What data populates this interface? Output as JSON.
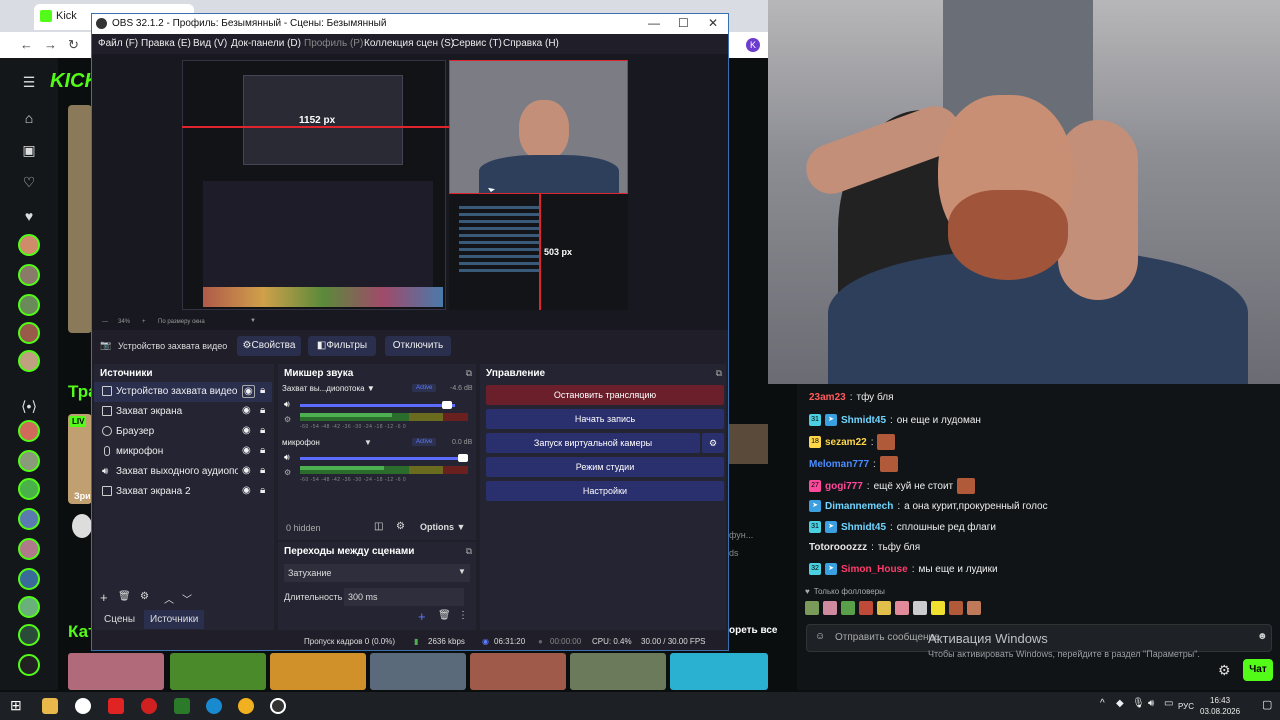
{
  "browser": {
    "tab_title": "Kick",
    "profile_letter": "K"
  },
  "kick": {
    "logo": "KICK",
    "following_letters": "Тра",
    "categories_letters": "Кат",
    "live_badge": "LIV",
    "name_partial": "Зри",
    "see_all": "ореть все",
    "fun_partial": "фун...",
    "ds_partial": "ds"
  },
  "chat": {
    "messages": [
      {
        "user": "23am23",
        "text": "тфу бля",
        "color": "#ff5a5a",
        "badges": []
      },
      {
        "user": "Shmidt45",
        "text": "он еще и лудоман",
        "color": "#6fd6ff",
        "badges": [
          "31",
          "p"
        ]
      },
      {
        "user": "sezam22",
        "text": "",
        "color": "#ffd84a",
        "badges": [
          "18"
        ],
        "emote": true
      },
      {
        "user": "Meloman777",
        "text": "",
        "color": "#4a8cff",
        "badges": [],
        "emote": true
      },
      {
        "user": "gogi777",
        "text": "ещё хуй не стоит",
        "color": "#ff4a9c",
        "badges": [
          "27"
        ],
        "emote": true
      },
      {
        "user": "Dimannemech",
        "text": "а она курит,прокуренный голос",
        "color": "#6fd6ff",
        "badges": [
          "p"
        ]
      },
      {
        "user": "Shmidt45",
        "text": "сплошные ред флаги",
        "color": "#6fd6ff",
        "badges": [
          "31",
          "p"
        ]
      },
      {
        "user": "Totorooozzz",
        "text": "тьфу бля",
        "color": "#e6e6e6",
        "badges": []
      },
      {
        "user": "Simon_House",
        "text": "мы еще и лудики",
        "color": "#ff3b6b",
        "badges": [
          "32",
          "p"
        ]
      }
    ],
    "followers_only": "Только фолловеры",
    "input_placeholder": "Отправить сообщение",
    "send_label": "Чат"
  },
  "windows_activation": {
    "title": "Активация Windows",
    "subtitle": "Чтобы активировать Windows, перейдите в раздел \"Параметры\"."
  },
  "obs": {
    "title": "OBS 32.1.2 - Профиль: Безымянный - Сцены: Безымянный",
    "menu": [
      "Файл (F)",
      "Правка (E)",
      "Вид (V)",
      "Док-панели (D)",
      "Профиль (P)",
      "Коллекция сцен (S)",
      "Сервис (T)",
      "Справка (H)"
    ],
    "preview": {
      "width_label": "1152 px",
      "height_label": "503 px",
      "zoom": "34%",
      "fit_label": "По размеру окна"
    },
    "selected_source": "Устройство захвата видео",
    "props_label": "Свойства",
    "filters_label": "Фильтры",
    "disable_label": "Отключить",
    "sources_title": "Источники",
    "sources": [
      {
        "name": "Устройство захвата видео",
        "icon": "camera-icon"
      },
      {
        "name": "Захват экрана",
        "icon": "monitor-icon"
      },
      {
        "name": "Браузер",
        "icon": "globe-icon"
      },
      {
        "name": "микрофон",
        "icon": "mic-icon"
      },
      {
        "name": "Захват выходного аудиопотока",
        "icon": "speaker-icon"
      },
      {
        "name": "Захват экрана 2",
        "icon": "monitor-icon"
      }
    ],
    "scenes_tab": "Сцены",
    "sources_tab": "Источники",
    "mixer_title": "Микшер звука",
    "mixer": [
      {
        "name": "Захват вы...диопотока",
        "status": "Active",
        "db": "-4.6 dB",
        "level": 0.55,
        "volume": 0.98
      },
      {
        "name": "микрофон",
        "status": "Active",
        "db": "0.0 dB",
        "level": 0.5,
        "volume": 1.0
      }
    ],
    "ticks": "-60  -54  -48  -42  -36  -30  -24  -18  -12  -6   0",
    "hidden_label": "0 hidden",
    "options_label": "Options",
    "transitions_title": "Переходы между сценами",
    "transition": "Затухание",
    "duration_label": "Длительность",
    "duration": "300 ms",
    "controls_title": "Управление",
    "controls": [
      "Остановить трансляцию",
      "Начать запись",
      "Запуск виртуальной камеры",
      "Режим студии",
      "Настройки"
    ],
    "status": {
      "dropped": "Пропуск кадров 0 (0.0%)",
      "bitrate": "2636 kbps",
      "stream_time": "06:31:20",
      "rec_time": "00:00:00",
      "cpu": "CPU: 0.4%",
      "fps": "30.00 / 30.00 FPS"
    }
  },
  "taskbar": {
    "lang": "РУС",
    "time": "16:43",
    "date": "03.08.2026"
  }
}
